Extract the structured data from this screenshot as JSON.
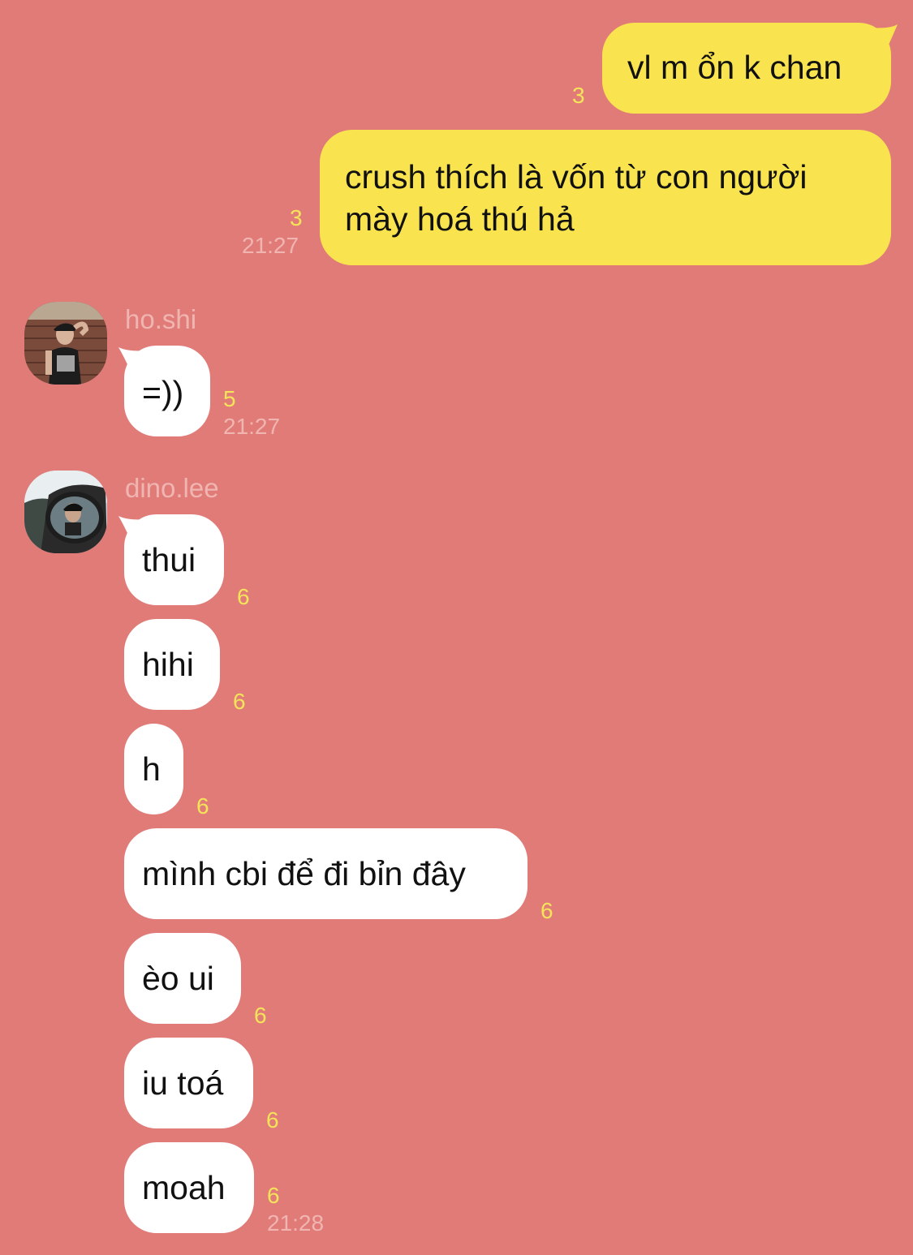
{
  "messages_out": [
    {
      "text": "vl m ổn k chan",
      "unread": "3",
      "time": ""
    },
    {
      "text": "crush thích là vốn từ con người mày hoá thú hả",
      "unread": "3",
      "time": "21:27"
    }
  ],
  "groups": [
    {
      "sender": "ho.shi",
      "avatar_icon": "profile-photo-icon",
      "messages": [
        {
          "text": "=))",
          "unread": "5",
          "time": "21:27"
        }
      ]
    },
    {
      "sender": "dino.lee",
      "avatar_icon": "profile-photo-icon",
      "messages": [
        {
          "text": "thui",
          "unread": "6",
          "time": ""
        },
        {
          "text": "hihi",
          "unread": "6",
          "time": ""
        },
        {
          "text": "h",
          "unread": "6",
          "time": ""
        },
        {
          "text": "mình cbi để đi bỉn đây",
          "unread": "6",
          "time": ""
        },
        {
          "text": "èo ui",
          "unread": "6",
          "time": ""
        },
        {
          "text": "iu toá",
          "unread": "6",
          "time": ""
        },
        {
          "text": "moah",
          "unread": "6",
          "time": "21:28"
        }
      ]
    }
  ],
  "colors": {
    "background": "#e07b78",
    "outgoing_bubble": "#f9e44f",
    "incoming_bubble": "#ffffff",
    "unread_count": "#f5e35a",
    "meta_text": "#f1b5b1"
  }
}
